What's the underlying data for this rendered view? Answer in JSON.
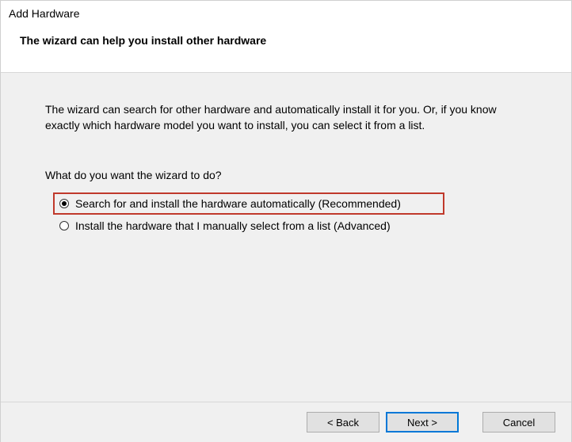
{
  "window": {
    "title": "Add Hardware",
    "subtitle": "The wizard can help you install other hardware"
  },
  "content": {
    "intro": "The wizard can search for other hardware and automatically install it for you. Or, if you know exactly which hardware model you want to install, you can select it from a list.",
    "prompt": "What do you want the wizard to do?",
    "options": [
      {
        "id": "opt-auto",
        "label": "Search for and install the hardware automatically (Recommended)",
        "checked": true
      },
      {
        "id": "opt-manual",
        "label": "Install the hardware that I manually select from a list (Advanced)",
        "checked": false
      }
    ]
  },
  "buttons": {
    "back": "< Back",
    "next": "Next >",
    "cancel": "Cancel"
  }
}
